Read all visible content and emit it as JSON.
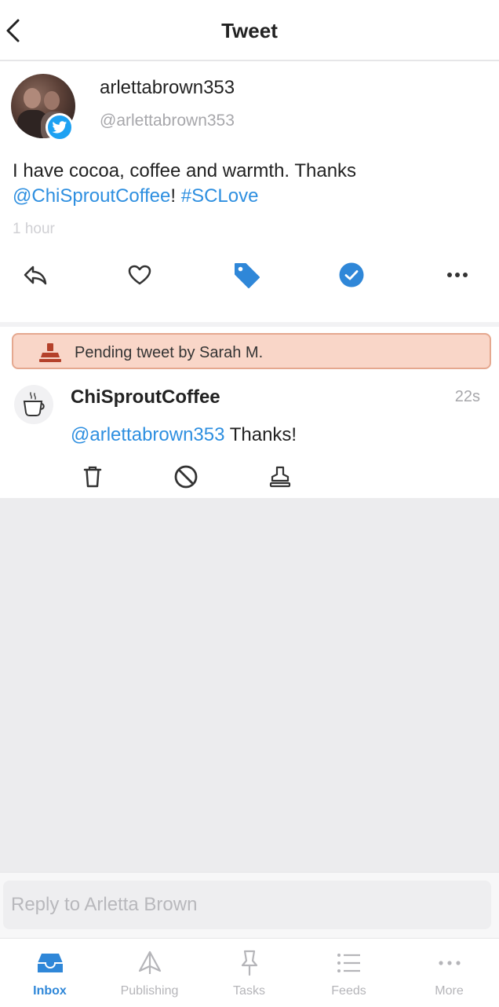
{
  "header": {
    "title": "Tweet"
  },
  "tweet": {
    "display_name": "arlettabrown353",
    "handle": "@arlettabrown353",
    "text_before": "I have cocoa, coffee and warmth. Thanks",
    "mention": "@ChiSproutCoffee",
    "text_after": "! ",
    "hashtag": "#SCLove",
    "time": "1 hour"
  },
  "pending": {
    "banner": "Pending tweet by Sarah M.",
    "author": "ChiSproutCoffee",
    "time": "22s",
    "mention": "@arlettabrown353",
    "text": " Thanks!"
  },
  "reply": {
    "placeholder": "Reply to Arletta Brown"
  },
  "tabs": [
    {
      "label": "Inbox",
      "icon": "inbox-icon",
      "active": true
    },
    {
      "label": "Publishing",
      "icon": "paper-plane-icon",
      "active": false
    },
    {
      "label": "Tasks",
      "icon": "pin-icon",
      "active": false
    },
    {
      "label": "Feeds",
      "icon": "list-icon",
      "active": false
    },
    {
      "label": "More",
      "icon": "ellipsis-icon",
      "active": false
    }
  ],
  "colors": {
    "accent": "#2f87d8",
    "link": "#2e8fe0",
    "twitter": "#1da1f2",
    "pending_bg": "#f9d6c8",
    "pending_border": "#e5a88f",
    "stamp": "#b4412a"
  }
}
